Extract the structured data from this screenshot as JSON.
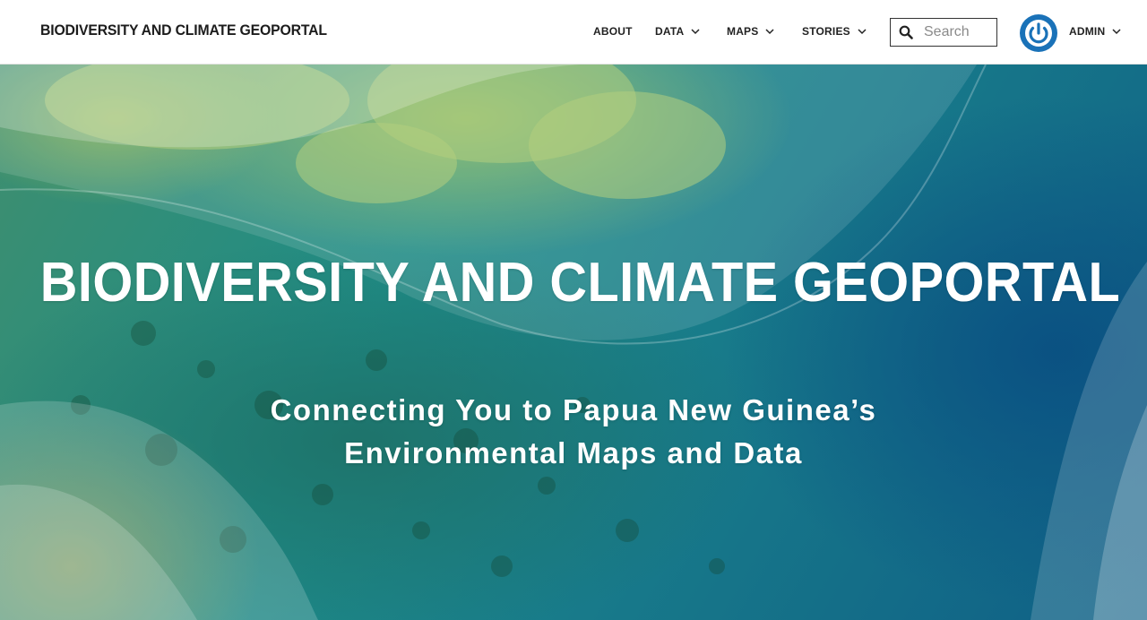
{
  "header": {
    "site_title": "BIODIVERSITY AND CLIMATE GEOPORTAL",
    "nav": [
      {
        "label": "ABOUT",
        "has_dropdown": false
      },
      {
        "label": "DATA",
        "has_dropdown": true
      },
      {
        "label": "MAPS",
        "has_dropdown": true
      },
      {
        "label": "STORIES",
        "has_dropdown": true
      }
    ],
    "search": {
      "placeholder": "Search",
      "value": ""
    },
    "user": {
      "label": "ADMIN",
      "avatar_icon": "power-icon",
      "avatar_color": "#1a72b8"
    }
  },
  "hero": {
    "title": "BIODIVERSITY AND CLIMATE GEOPORTAL",
    "subtitle_line1": "Connecting You to Papua New Guinea’s",
    "subtitle_line2": "Environmental Maps and Data"
  },
  "colors": {
    "header_bg": "#ffffff",
    "header_text": "#1c1c1c",
    "hero_water": "#187b8a",
    "hero_text": "#ffffff"
  }
}
